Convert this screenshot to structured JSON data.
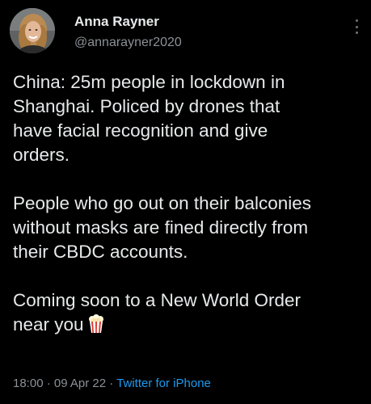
{
  "author": {
    "display_name": "Anna Rayner",
    "handle": "@annarayner2020"
  },
  "menu": {
    "icon": "more-vertical-icon"
  },
  "tweet": {
    "paragraphs": [
      "China: 25m people in lockdown in\nShanghai. Policed by drones that\nhave facial recognition and give\norders.",
      "People who go out on their balconies\nwithout masks are fined directly from\ntheir CBDC accounts.",
      "Coming soon to a New World Order\nnear you"
    ],
    "emoji": "popcorn-icon"
  },
  "meta": {
    "time": "18:00",
    "separator1": " · ",
    "date": "09 Apr 22",
    "separator2": " · ",
    "source": "Twitter for iPhone"
  },
  "colors": {
    "background": "#000000",
    "text": "#e7e9ea",
    "secondary": "#8b9196",
    "link": "#1d9bf0"
  }
}
